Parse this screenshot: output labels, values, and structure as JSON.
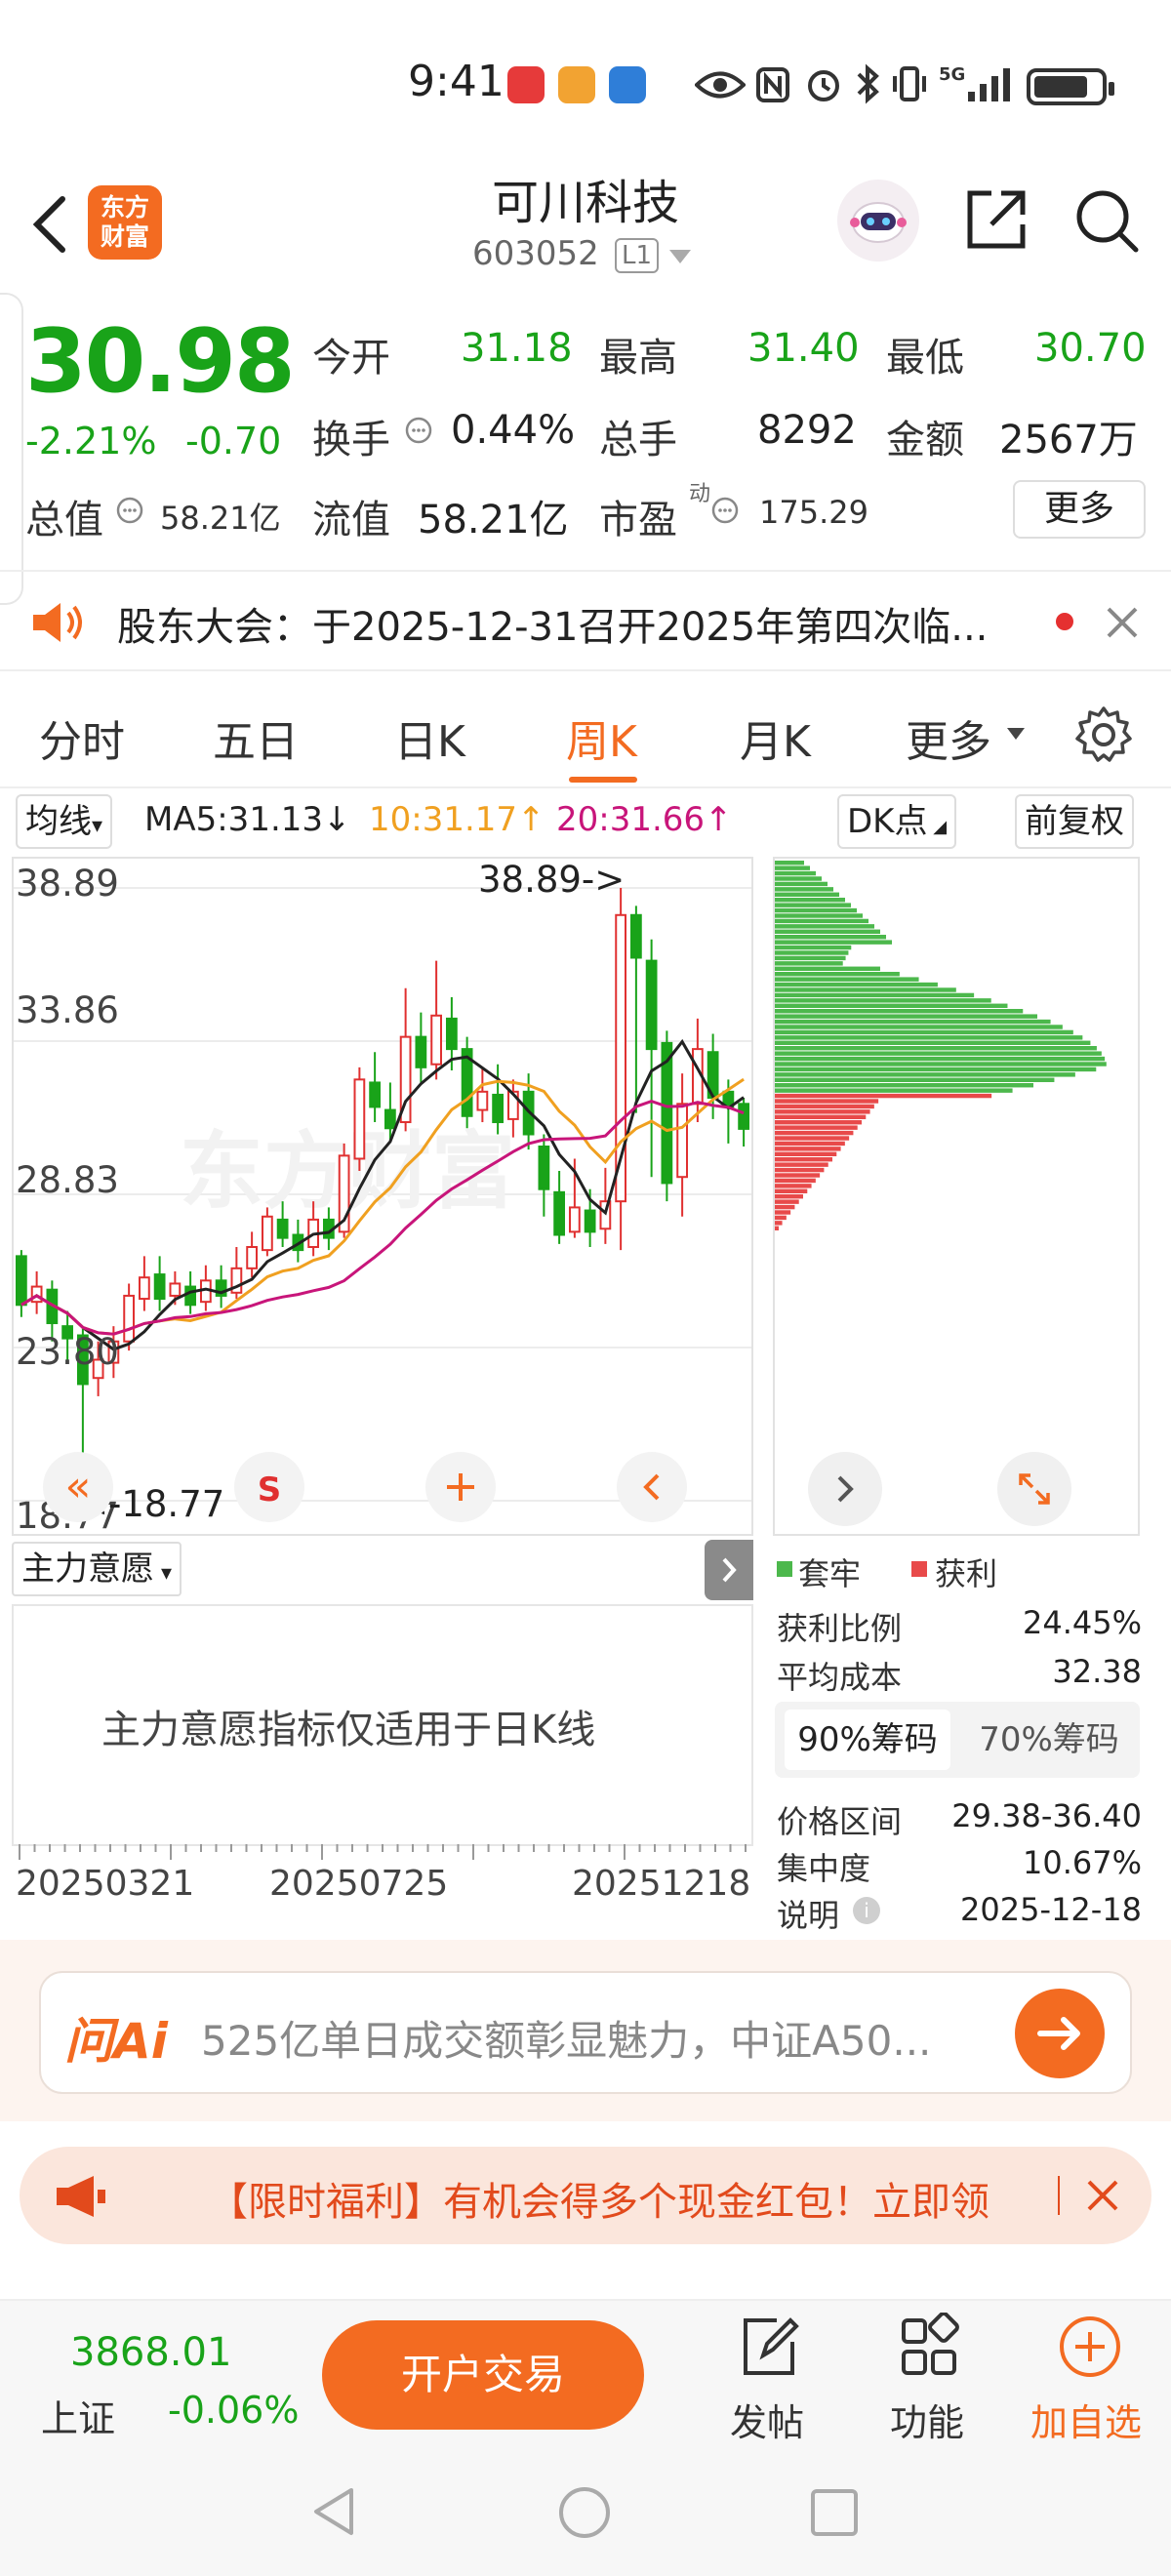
{
  "status_bar": {
    "time": "9:41",
    "network_label": "5G"
  },
  "header": {
    "logo_line1": "东方",
    "logo_line2": "财富",
    "stock_name": "可川科技",
    "stock_code": "603052",
    "level_badge": "L1"
  },
  "quote": {
    "price": "30.98",
    "change_pct": "-2.21%",
    "change_amt": "-0.70",
    "open_label": "今开",
    "open": "31.18",
    "high_label": "最高",
    "high": "31.40",
    "low_label": "最低",
    "low": "30.70",
    "turnover_label": "换手",
    "turnover": "0.44%",
    "volume_label": "总手",
    "volume": "8292",
    "amount_label": "金额",
    "amount": "2567万",
    "mktcap_label": "总值",
    "mktcap": "58.21亿",
    "float_label": "流值",
    "float": "58.21亿",
    "pe_label": "市盈",
    "pe_sup": "动",
    "pe": "175.29",
    "more_label": "更多"
  },
  "notice": {
    "text": "股东大会：于2025-12-31召开2025年第四次临..."
  },
  "tabs": [
    {
      "label": "分时"
    },
    {
      "label": "五日"
    },
    {
      "label": "日K"
    },
    {
      "label": "周K"
    },
    {
      "label": "月K"
    },
    {
      "label": "更多"
    }
  ],
  "indicator": {
    "selector_label": "均线",
    "ma5": "MA5:31.13↓",
    "ma10": "10:31.17↑",
    "ma20": "20:31.66↑",
    "dk_label": "DK点",
    "adjust_label": "前复权",
    "colors": {
      "ma5": "#222222",
      "ma10": "#f0a020",
      "ma20": "#c8157a",
      "up": "#e03030",
      "down": "#19a319"
    }
  },
  "chart_data": {
    "type": "candlestick",
    "period": "week",
    "ylim": [
      18.77,
      38.89
    ],
    "y_ticks": [
      "38.89",
      "33.86",
      "28.83",
      "23.80",
      "18.77"
    ],
    "x_labels": [
      "20250321",
      "20250725",
      "20251218"
    ],
    "max_marker": "38.89->",
    "min_marker": "<-18.77",
    "candles": [
      [
        26.8,
        25.2,
        27.0,
        24.8
      ],
      [
        25.3,
        25.8,
        26.3,
        24.9
      ],
      [
        25.7,
        24.6,
        26.0,
        24.0
      ],
      [
        24.5,
        24.1,
        25.0,
        23.4
      ],
      [
        24.2,
        22.6,
        24.5,
        18.77
      ],
      [
        22.8,
        23.4,
        24.0,
        22.2
      ],
      [
        23.3,
        24.0,
        24.5,
        22.8
      ],
      [
        24.0,
        25.5,
        25.9,
        23.7
      ],
      [
        25.4,
        26.1,
        26.8,
        25.0
      ],
      [
        26.2,
        25.4,
        26.8,
        25.0
      ],
      [
        25.5,
        25.9,
        26.3,
        25.2
      ],
      [
        25.8,
        25.2,
        26.3,
        24.9
      ],
      [
        25.3,
        26.0,
        26.5,
        25.0
      ],
      [
        26.0,
        25.5,
        26.5,
        25.1
      ],
      [
        25.6,
        26.4,
        27.1,
        25.4
      ],
      [
        26.4,
        27.1,
        27.6,
        26.1
      ],
      [
        27.0,
        28.1,
        28.4,
        26.8
      ],
      [
        28.0,
        27.4,
        28.6,
        27.1
      ],
      [
        27.5,
        27.0,
        28.0,
        26.6
      ],
      [
        27.1,
        28.0,
        28.6,
        26.8
      ],
      [
        28.0,
        27.4,
        28.4,
        27.0
      ],
      [
        27.6,
        30.1,
        30.5,
        27.4
      ],
      [
        30.0,
        32.6,
        33.0,
        29.6
      ],
      [
        32.5,
        31.7,
        33.5,
        31.2
      ],
      [
        31.6,
        31.0,
        32.5,
        30.6
      ],
      [
        31.2,
        34.0,
        35.6,
        30.9
      ],
      [
        34.0,
        33.0,
        34.8,
        32.5
      ],
      [
        33.1,
        34.7,
        36.5,
        32.6
      ],
      [
        34.6,
        33.6,
        35.3,
        32.9
      ],
      [
        33.6,
        31.4,
        34.0,
        31.0
      ],
      [
        31.6,
        32.2,
        33.0,
        31.2
      ],
      [
        32.1,
        31.2,
        33.1,
        30.8
      ],
      [
        31.3,
        32.2,
        32.6,
        30.7
      ],
      [
        32.2,
        30.8,
        32.8,
        30.3
      ],
      [
        30.4,
        29.0,
        30.8,
        28.1
      ],
      [
        28.9,
        27.5,
        29.6,
        27.2
      ],
      [
        27.6,
        28.4,
        30.0,
        27.4
      ],
      [
        28.3,
        27.6,
        29.0,
        27.1
      ],
      [
        27.7,
        28.6,
        29.7,
        27.2
      ],
      [
        28.6,
        38.0,
        38.89,
        27.0
      ],
      [
        38.0,
        36.6,
        38.3,
        31.5
      ],
      [
        36.5,
        33.6,
        37.2,
        29.4
      ],
      [
        33.8,
        29.2,
        34.2,
        28.6
      ],
      [
        29.4,
        31.8,
        32.8,
        28.1
      ],
      [
        31.8,
        33.6,
        34.6,
        31.2
      ],
      [
        33.5,
        32.0,
        34.1,
        31.3
      ],
      [
        32.2,
        31.7,
        32.6,
        30.5
      ],
      [
        31.8,
        30.98,
        32.0,
        30.4
      ]
    ]
  },
  "chart_controls": {
    "fast_back": "«",
    "sell_marker": "S"
  },
  "sub_indicator": {
    "selector_label": "主力意愿",
    "message": "主力意愿指标仅适用于日K线"
  },
  "chip_dist": {
    "legend_trapped": "套牢",
    "legend_profit": "获利",
    "profit_ratio_label": "获利比例",
    "profit_ratio": "24.45%",
    "avg_cost_label": "平均成本",
    "avg_cost": "32.38",
    "seg_90": "90%筹码",
    "seg_70": "70%筹码",
    "range_label": "价格区间",
    "range": "29.38-36.40",
    "concentration_label": "集中度",
    "concentration": "10.67%",
    "explain_label": "说明",
    "date": "2025-12-18",
    "colors": {
      "trapped": "#4cb84c",
      "profit": "#e84a4a"
    }
  },
  "ai": {
    "logo": "问Ai",
    "prompt": "525亿单日成交额彰显魅力，中证A50..."
  },
  "promo": {
    "text": "【限时福利】有机会得多个现金红包！立即领"
  },
  "bottom_bar": {
    "index_value": "3868.01",
    "index_name": "上证",
    "index_change": "-0.06%",
    "trade_label": "开户交易",
    "post_label": "发帖",
    "func_label": "功能",
    "watch_label": "加自选"
  }
}
